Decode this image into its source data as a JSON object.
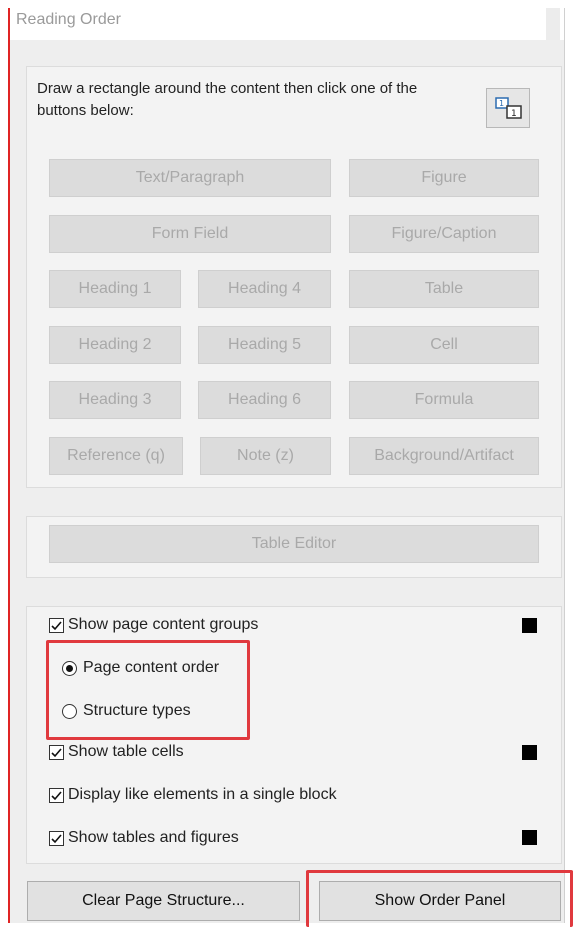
{
  "window": {
    "title": "Reading Order"
  },
  "instruction": "Draw a rectangle around the content then click one of the buttons below:",
  "icon_button": {
    "icon": "reading-order-tool-icon"
  },
  "tag_buttons": {
    "text_paragraph": "Text/Paragraph",
    "figure": "Figure",
    "form_field": "Form Field",
    "figure_caption": "Figure/Caption",
    "heading1": "Heading 1",
    "heading4": "Heading 4",
    "table": "Table",
    "heading2": "Heading 2",
    "heading5": "Heading 5",
    "cell": "Cell",
    "heading3": "Heading 3",
    "heading6": "Heading 6",
    "formula": "Formula",
    "reference": "Reference (q)",
    "note": "Note (z)",
    "background_artifact": "Background/Artifact"
  },
  "table_editor": "Table Editor",
  "options": {
    "show_page_content_groups": {
      "label": "Show page content groups",
      "checked": true
    },
    "page_content_order": {
      "label": "Page content order",
      "selected": true
    },
    "structure_types": {
      "label": "Structure types",
      "selected": false
    },
    "show_table_cells": {
      "label": "Show table cells",
      "checked": true
    },
    "display_like_elements": {
      "label": "Display like elements in a single block",
      "checked": true
    },
    "show_tables_figures": {
      "label": "Show tables and figures",
      "checked": true
    }
  },
  "bottom_buttons": {
    "clear_page_structure": "Clear Page Structure...",
    "show_order_panel": "Show Order Panel"
  },
  "colors": {
    "highlight": "#e0393e",
    "swatch": "#000000"
  }
}
